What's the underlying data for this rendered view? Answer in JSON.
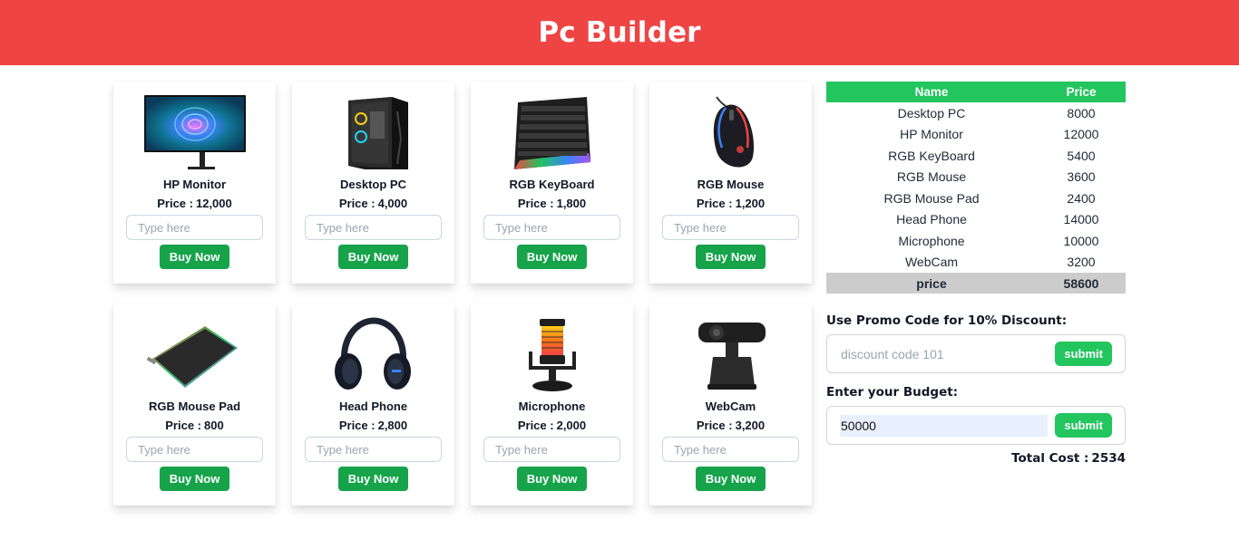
{
  "header": {
    "title": "Pc Builder"
  },
  "products": [
    {
      "name": "HP Monitor",
      "price_label": "Price :",
      "price": "12,000",
      "placeholder": "Type here",
      "buy_label": "Buy Now",
      "icon": "monitor-image"
    },
    {
      "name": "Desktop PC",
      "price_label": "Price :",
      "price": "4,000",
      "placeholder": "Type here",
      "buy_label": "Buy Now",
      "icon": "desktop-pc-image"
    },
    {
      "name": "RGB KeyBoard",
      "price_label": "Price :",
      "price": "1,800",
      "placeholder": "Type here",
      "buy_label": "Buy Now",
      "icon": "keyboard-image"
    },
    {
      "name": "RGB Mouse",
      "price_label": "Price :",
      "price": "1,200",
      "placeholder": "Type here",
      "buy_label": "Buy Now",
      "icon": "mouse-image"
    },
    {
      "name": "RGB Mouse Pad",
      "price_label": "Price :",
      "price": "800",
      "placeholder": "Type here",
      "buy_label": "Buy Now",
      "icon": "mouse-pad-image"
    },
    {
      "name": "Head Phone",
      "price_label": "Price :",
      "price": "2,800",
      "placeholder": "Type here",
      "buy_label": "Buy Now",
      "icon": "headphone-image"
    },
    {
      "name": "Microphone",
      "price_label": "Price :",
      "price": "2,000",
      "placeholder": "Type here",
      "buy_label": "Buy Now",
      "icon": "microphone-image"
    },
    {
      "name": "WebCam",
      "price_label": "Price :",
      "price": "3,200",
      "placeholder": "Type here",
      "buy_label": "Buy Now",
      "icon": "webcam-image"
    }
  ],
  "summary": {
    "headers": {
      "name": "Name",
      "price": "Price"
    },
    "rows": [
      {
        "name": "Desktop PC",
        "price": "8000"
      },
      {
        "name": "HP Monitor",
        "price": "12000"
      },
      {
        "name": "RGB KeyBoard",
        "price": "5400"
      },
      {
        "name": "RGB Mouse",
        "price": "3600"
      },
      {
        "name": "RGB Mouse Pad",
        "price": "2400"
      },
      {
        "name": "Head Phone",
        "price": "14000"
      },
      {
        "name": "Microphone",
        "price": "10000"
      },
      {
        "name": "WebCam",
        "price": "3200"
      }
    ],
    "total": {
      "label": "price",
      "value": "58600"
    }
  },
  "promo": {
    "label": "Use Promo Code for 10% Discount:",
    "placeholder": "discount code 101",
    "submit_label": "submit"
  },
  "budget": {
    "label": "Enter your Budget:",
    "value": "50000",
    "submit_label": "submit"
  },
  "total_cost": {
    "label": "Total Cost :",
    "value": "2534"
  },
  "colors": {
    "header": "#ef4444",
    "buy_button": "#16a34a",
    "submit_button": "#22c55e",
    "table_header": "#22c55e",
    "total_row": "#cccccc",
    "budget_autofill": "#e8f0fe"
  }
}
